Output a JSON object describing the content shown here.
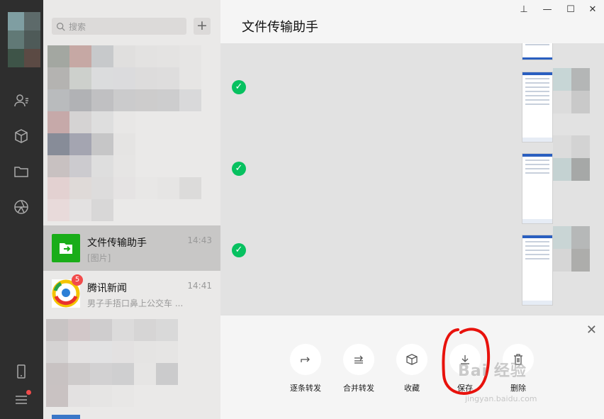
{
  "chat_list": {
    "search_placeholder": "搜索",
    "add_label": "+",
    "items": [
      {
        "name": "文件传输助手",
        "time": "14:43",
        "preview": "[图片]"
      },
      {
        "name": "腾讯新闻",
        "time": "14:41",
        "preview": "男子手捂口鼻上公交车 ...",
        "badge": "5"
      }
    ]
  },
  "main": {
    "title": "文件传输助手"
  },
  "window_controls": {
    "pin": "⊥",
    "minimize": "—",
    "maximize": "☐",
    "close": "✕"
  },
  "actions": [
    {
      "label": "逐条转发",
      "icon": "forward-icon"
    },
    {
      "label": "合并转发",
      "icon": "merge-forward-icon"
    },
    {
      "label": "收藏",
      "icon": "favorite-box-icon"
    },
    {
      "label": "保存",
      "icon": "download-icon"
    },
    {
      "label": "删除",
      "icon": "trash-icon"
    }
  ],
  "panel_close": "✕",
  "watermark": {
    "text": "Bai 经验",
    "sub": "jingyan.baidu.com"
  },
  "colors": {
    "accent_green": "#07c160",
    "sidebar_dark": "#2e2e2e",
    "badge_red": "#f24b4b"
  }
}
